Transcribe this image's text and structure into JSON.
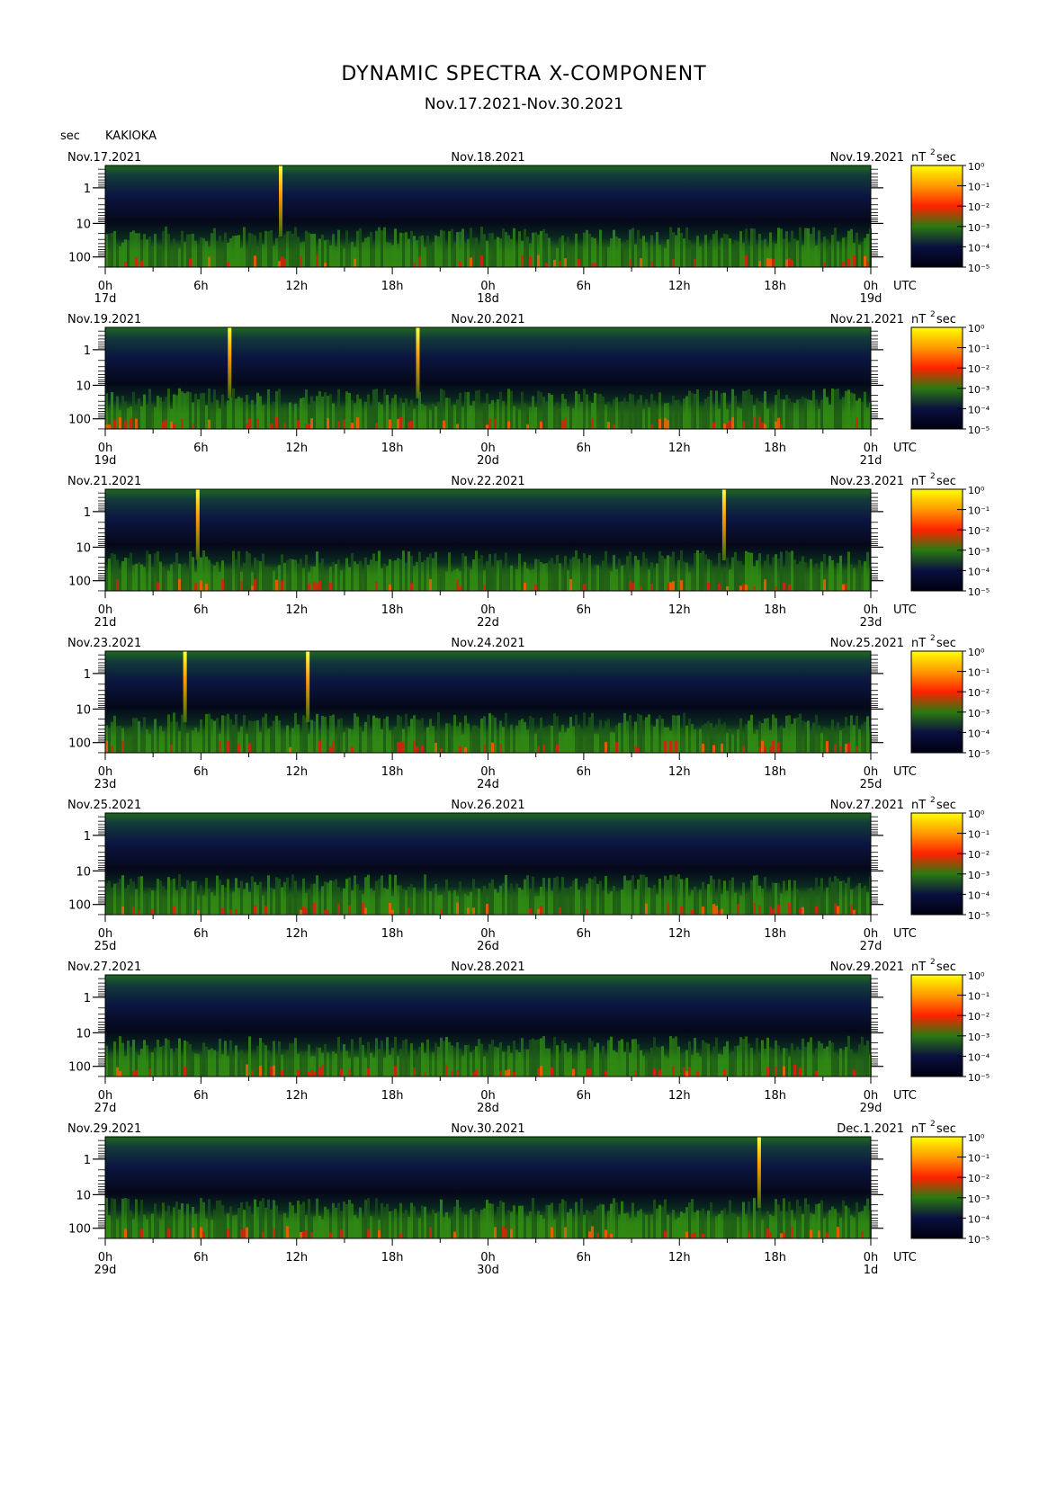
{
  "header": {
    "title": "DYNAMIC SPECTRA X-COMPONENT",
    "subtitle": "Nov.17.2021-Nov.30.2021",
    "y_unit": "sec",
    "station": "KAKIOKA",
    "colorbar_unit_left": "nT",
    "colorbar_unit_exp": "2",
    "colorbar_unit_right": "sec",
    "utc_label": "UTC"
  },
  "chart_data": {
    "type": "heatmap",
    "description_fields_are_printed_labels_only": true,
    "y_ticks": [
      "1",
      "10",
      "100"
    ],
    "x_ticks": [
      "0h",
      "6h",
      "12h",
      "18h",
      "0h",
      "6h",
      "12h",
      "18h",
      "0h"
    ],
    "colorbar_ticks": [
      "10⁰",
      "10⁻¹",
      "10⁻²",
      "10⁻³",
      "10⁻⁴",
      "10⁻⁵"
    ],
    "colormap": [
      "#ffff00",
      "#ff9900",
      "#ff2200",
      "#2a7a10",
      "#0a1040",
      "#000010"
    ],
    "panels": [
      {
        "date_left": "Nov.17.2021",
        "date_mid": "Nov.18.2021",
        "date_right": "Nov.19.2021",
        "day_left": "17d",
        "day_mid": "18d",
        "day_right": "19d",
        "spikes_hour": [
          11
        ]
      },
      {
        "date_left": "Nov.19.2021",
        "date_mid": "Nov.20.2021",
        "date_right": "Nov.21.2021",
        "day_left": "19d",
        "day_mid": "20d",
        "day_right": "21d",
        "spikes_hour": [
          7.8,
          19.6
        ]
      },
      {
        "date_left": "Nov.21.2021",
        "date_mid": "Nov.22.2021",
        "date_right": "Nov.23.2021",
        "day_left": "21d",
        "day_mid": "22d",
        "day_right": "23d",
        "spikes_hour": [
          5.8,
          38.8
        ]
      },
      {
        "date_left": "Nov.23.2021",
        "date_mid": "Nov.24.2021",
        "date_right": "Nov.25.2021",
        "day_left": "23d",
        "day_mid": "24d",
        "day_right": "25d",
        "spikes_hour": [
          5,
          12.7
        ]
      },
      {
        "date_left": "Nov.25.2021",
        "date_mid": "Nov.26.2021",
        "date_right": "Nov.27.2021",
        "day_left": "25d",
        "day_mid": "26d",
        "day_right": "27d",
        "spikes_hour": []
      },
      {
        "date_left": "Nov.27.2021",
        "date_mid": "Nov.28.2021",
        "date_right": "Nov.29.2021",
        "day_left": "27d",
        "day_mid": "28d",
        "day_right": "29d",
        "spikes_hour": []
      },
      {
        "date_left": "Nov.29.2021",
        "date_mid": "Nov.30.2021",
        "date_right": "Dec.1.2021",
        "day_left": "29d",
        "day_mid": "30d",
        "day_right": "1d",
        "spikes_hour": [
          41
        ]
      }
    ]
  }
}
